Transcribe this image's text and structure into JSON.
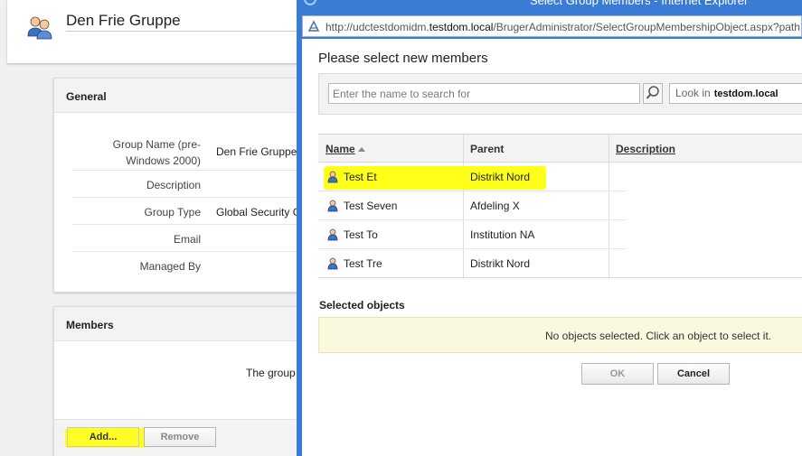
{
  "group": {
    "title": "Den Frie Gruppe",
    "icon": "group-users-icon"
  },
  "general": {
    "heading": "General",
    "fields": [
      {
        "label": "Group Name (pre-Windows 2000)",
        "value": "Den Frie Gruppe"
      },
      {
        "label": "Description",
        "value": ""
      },
      {
        "label": "Group Type",
        "value": "Global Security G"
      },
      {
        "label": "Email",
        "value": ""
      },
      {
        "label": "Managed By",
        "value": ""
      }
    ]
  },
  "members": {
    "heading": "Members",
    "text": "The group",
    "add_label": "Add...",
    "remove_label": "Remove"
  },
  "popup": {
    "window_title": "Select Group Members - Internet Explorer",
    "url_prefix": "http://udctestdomidm.",
    "url_domain": "testdom.local",
    "url_rest": "/BrugerAdministrator/SelectGroupMembershipObject.aspx?path",
    "dialog_title": "Please select new members",
    "search": {
      "placeholder": "Enter the name to search for",
      "lookin_label": "Look in",
      "lookin_value": "testdom.local"
    },
    "columns": {
      "name": "Name",
      "parent": "Parent",
      "description": "Description"
    },
    "rows": [
      {
        "name": "Test Et",
        "parent": "Distrikt Nord",
        "highlighted": true
      },
      {
        "name": "Test Seven",
        "parent": "Afdeling X",
        "highlighted": false
      },
      {
        "name": "Test To",
        "parent": "Institution NA",
        "highlighted": false
      },
      {
        "name": "Test Tre",
        "parent": "Distrikt Nord",
        "highlighted": false
      }
    ],
    "selected_label": "Selected objects",
    "selected_message": "No objects selected. Click an object to select it.",
    "ok_label": "OK",
    "cancel_label": "Cancel"
  },
  "colors": {
    "highlight": "#ffff00",
    "window_frame": "#3a7bd5",
    "selected_box": "#fbf8e0"
  }
}
